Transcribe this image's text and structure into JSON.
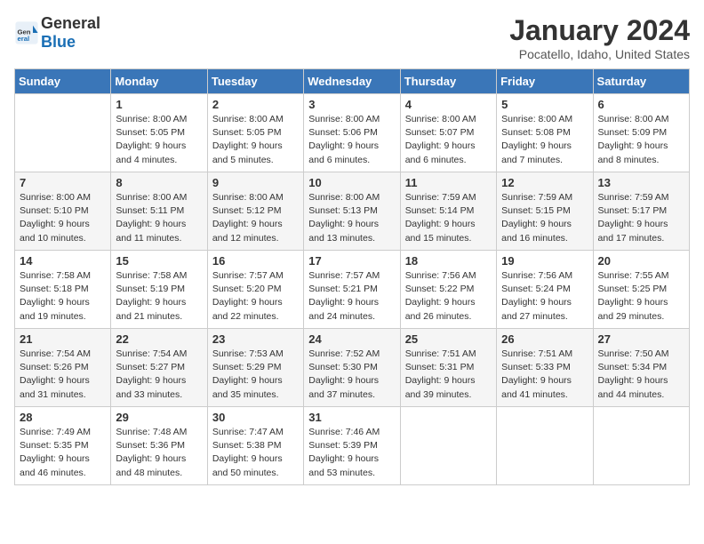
{
  "header": {
    "logo_general": "General",
    "logo_blue": "Blue",
    "month_title": "January 2024",
    "location": "Pocatello, Idaho, United States"
  },
  "weekdays": [
    "Sunday",
    "Monday",
    "Tuesday",
    "Wednesday",
    "Thursday",
    "Friday",
    "Saturday"
  ],
  "weeks": [
    [
      {
        "day": "",
        "sunrise": "",
        "sunset": "",
        "daylight": ""
      },
      {
        "day": "1",
        "sunrise": "Sunrise: 8:00 AM",
        "sunset": "Sunset: 5:05 PM",
        "daylight": "Daylight: 9 hours and 4 minutes."
      },
      {
        "day": "2",
        "sunrise": "Sunrise: 8:00 AM",
        "sunset": "Sunset: 5:05 PM",
        "daylight": "Daylight: 9 hours and 5 minutes."
      },
      {
        "day": "3",
        "sunrise": "Sunrise: 8:00 AM",
        "sunset": "Sunset: 5:06 PM",
        "daylight": "Daylight: 9 hours and 6 minutes."
      },
      {
        "day": "4",
        "sunrise": "Sunrise: 8:00 AM",
        "sunset": "Sunset: 5:07 PM",
        "daylight": "Daylight: 9 hours and 6 minutes."
      },
      {
        "day": "5",
        "sunrise": "Sunrise: 8:00 AM",
        "sunset": "Sunset: 5:08 PM",
        "daylight": "Daylight: 9 hours and 7 minutes."
      },
      {
        "day": "6",
        "sunrise": "Sunrise: 8:00 AM",
        "sunset": "Sunset: 5:09 PM",
        "daylight": "Daylight: 9 hours and 8 minutes."
      }
    ],
    [
      {
        "day": "7",
        "sunrise": "Sunrise: 8:00 AM",
        "sunset": "Sunset: 5:10 PM",
        "daylight": "Daylight: 9 hours and 10 minutes."
      },
      {
        "day": "8",
        "sunrise": "Sunrise: 8:00 AM",
        "sunset": "Sunset: 5:11 PM",
        "daylight": "Daylight: 9 hours and 11 minutes."
      },
      {
        "day": "9",
        "sunrise": "Sunrise: 8:00 AM",
        "sunset": "Sunset: 5:12 PM",
        "daylight": "Daylight: 9 hours and 12 minutes."
      },
      {
        "day": "10",
        "sunrise": "Sunrise: 8:00 AM",
        "sunset": "Sunset: 5:13 PM",
        "daylight": "Daylight: 9 hours and 13 minutes."
      },
      {
        "day": "11",
        "sunrise": "Sunrise: 7:59 AM",
        "sunset": "Sunset: 5:14 PM",
        "daylight": "Daylight: 9 hours and 15 minutes."
      },
      {
        "day": "12",
        "sunrise": "Sunrise: 7:59 AM",
        "sunset": "Sunset: 5:15 PM",
        "daylight": "Daylight: 9 hours and 16 minutes."
      },
      {
        "day": "13",
        "sunrise": "Sunrise: 7:59 AM",
        "sunset": "Sunset: 5:17 PM",
        "daylight": "Daylight: 9 hours and 17 minutes."
      }
    ],
    [
      {
        "day": "14",
        "sunrise": "Sunrise: 7:58 AM",
        "sunset": "Sunset: 5:18 PM",
        "daylight": "Daylight: 9 hours and 19 minutes."
      },
      {
        "day": "15",
        "sunrise": "Sunrise: 7:58 AM",
        "sunset": "Sunset: 5:19 PM",
        "daylight": "Daylight: 9 hours and 21 minutes."
      },
      {
        "day": "16",
        "sunrise": "Sunrise: 7:57 AM",
        "sunset": "Sunset: 5:20 PM",
        "daylight": "Daylight: 9 hours and 22 minutes."
      },
      {
        "day": "17",
        "sunrise": "Sunrise: 7:57 AM",
        "sunset": "Sunset: 5:21 PM",
        "daylight": "Daylight: 9 hours and 24 minutes."
      },
      {
        "day": "18",
        "sunrise": "Sunrise: 7:56 AM",
        "sunset": "Sunset: 5:22 PM",
        "daylight": "Daylight: 9 hours and 26 minutes."
      },
      {
        "day": "19",
        "sunrise": "Sunrise: 7:56 AM",
        "sunset": "Sunset: 5:24 PM",
        "daylight": "Daylight: 9 hours and 27 minutes."
      },
      {
        "day": "20",
        "sunrise": "Sunrise: 7:55 AM",
        "sunset": "Sunset: 5:25 PM",
        "daylight": "Daylight: 9 hours and 29 minutes."
      }
    ],
    [
      {
        "day": "21",
        "sunrise": "Sunrise: 7:54 AM",
        "sunset": "Sunset: 5:26 PM",
        "daylight": "Daylight: 9 hours and 31 minutes."
      },
      {
        "day": "22",
        "sunrise": "Sunrise: 7:54 AM",
        "sunset": "Sunset: 5:27 PM",
        "daylight": "Daylight: 9 hours and 33 minutes."
      },
      {
        "day": "23",
        "sunrise": "Sunrise: 7:53 AM",
        "sunset": "Sunset: 5:29 PM",
        "daylight": "Daylight: 9 hours and 35 minutes."
      },
      {
        "day": "24",
        "sunrise": "Sunrise: 7:52 AM",
        "sunset": "Sunset: 5:30 PM",
        "daylight": "Daylight: 9 hours and 37 minutes."
      },
      {
        "day": "25",
        "sunrise": "Sunrise: 7:51 AM",
        "sunset": "Sunset: 5:31 PM",
        "daylight": "Daylight: 9 hours and 39 minutes."
      },
      {
        "day": "26",
        "sunrise": "Sunrise: 7:51 AM",
        "sunset": "Sunset: 5:33 PM",
        "daylight": "Daylight: 9 hours and 41 minutes."
      },
      {
        "day": "27",
        "sunrise": "Sunrise: 7:50 AM",
        "sunset": "Sunset: 5:34 PM",
        "daylight": "Daylight: 9 hours and 44 minutes."
      }
    ],
    [
      {
        "day": "28",
        "sunrise": "Sunrise: 7:49 AM",
        "sunset": "Sunset: 5:35 PM",
        "daylight": "Daylight: 9 hours and 46 minutes."
      },
      {
        "day": "29",
        "sunrise": "Sunrise: 7:48 AM",
        "sunset": "Sunset: 5:36 PM",
        "daylight": "Daylight: 9 hours and 48 minutes."
      },
      {
        "day": "30",
        "sunrise": "Sunrise: 7:47 AM",
        "sunset": "Sunset: 5:38 PM",
        "daylight": "Daylight: 9 hours and 50 minutes."
      },
      {
        "day": "31",
        "sunrise": "Sunrise: 7:46 AM",
        "sunset": "Sunset: 5:39 PM",
        "daylight": "Daylight: 9 hours and 53 minutes."
      },
      {
        "day": "",
        "sunrise": "",
        "sunset": "",
        "daylight": ""
      },
      {
        "day": "",
        "sunrise": "",
        "sunset": "",
        "daylight": ""
      },
      {
        "day": "",
        "sunrise": "",
        "sunset": "",
        "daylight": ""
      }
    ]
  ]
}
